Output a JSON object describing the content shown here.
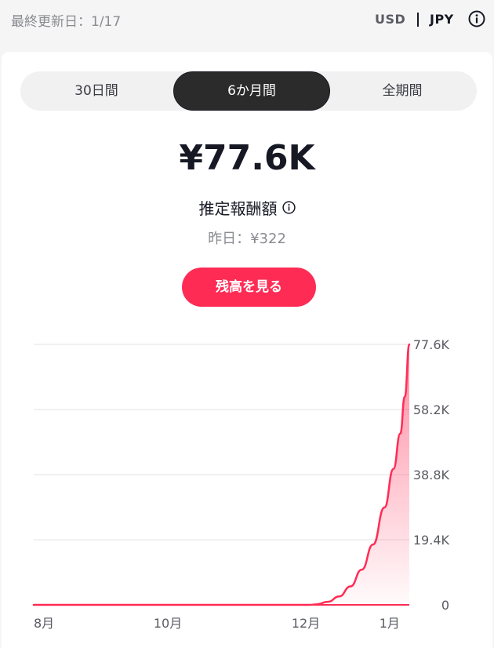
{
  "header": {
    "last_updated": "最終更新日：1/17",
    "currency_usd": "USD",
    "currency_jpy": "JPY",
    "selected_currency": "JPY"
  },
  "tabs": [
    {
      "label": "30日間",
      "selected": false
    },
    {
      "label": "6か月間",
      "selected": true
    },
    {
      "label": "全期間",
      "selected": false
    }
  ],
  "summary": {
    "amount": "¥77.6K",
    "label": "推定報酬額",
    "yesterday": "昨日：¥322",
    "balance_button": "残高を見る"
  },
  "colors": {
    "accent": "#fe2c55",
    "text": "#161823",
    "muted": "#8a8b91"
  },
  "chart_data": {
    "type": "area",
    "x_tick_labels": [
      "8月",
      "10月",
      "12月",
      "1月"
    ],
    "y_tick_labels": [
      "0",
      "19.4K",
      "38.8K",
      "58.2K",
      "77.6K"
    ],
    "ylim": [
      0,
      77600
    ],
    "xlim": [
      0,
      166
    ],
    "x_tick_positions": [
      0,
      61,
      122,
      159
    ],
    "grid": true,
    "series": [
      {
        "x": [
          0,
          20,
          40,
          61,
          80,
          100,
          122,
          125,
          130,
          135,
          140,
          145,
          150,
          155,
          159,
          162,
          164,
          166
        ],
        "values": [
          0,
          0,
          0,
          0,
          0,
          0,
          0,
          150,
          900,
          2500,
          5500,
          10500,
          18000,
          29000,
          40500,
          51000,
          62000,
          77600
        ]
      }
    ]
  }
}
